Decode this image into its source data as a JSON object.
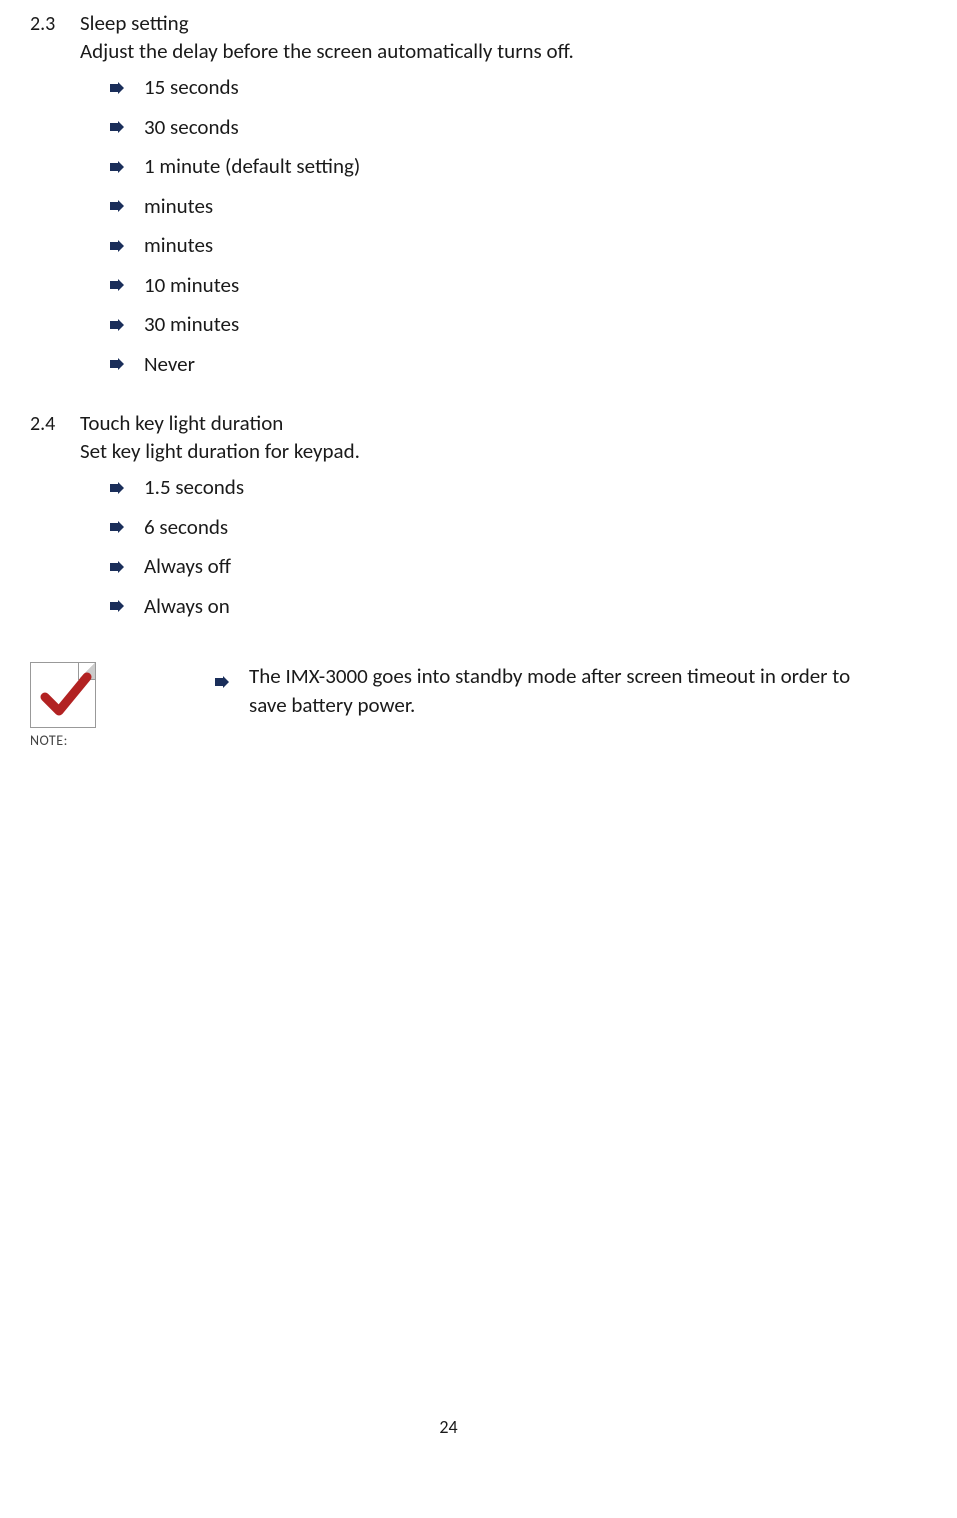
{
  "sections": [
    {
      "number": "2.3",
      "title": "Sleep setting",
      "description": "Adjust the delay before the screen automatically turns off.",
      "items": [
        "15 seconds",
        "30 seconds",
        "1 minute (default setting)",
        "minutes",
        "minutes",
        "10 minutes",
        "30 minutes",
        "Never"
      ]
    },
    {
      "number": "2.4",
      "title": "Touch key light duration",
      "description": "Set key light duration for keypad.",
      "items": [
        "1.5 seconds",
        "6 seconds",
        "Always off",
        "Always on"
      ]
    }
  ],
  "note": {
    "label": "NOTE:",
    "text": "The IMX-3000 goes into standby mode after screen timeout in order to save battery power."
  },
  "page_number": "24"
}
